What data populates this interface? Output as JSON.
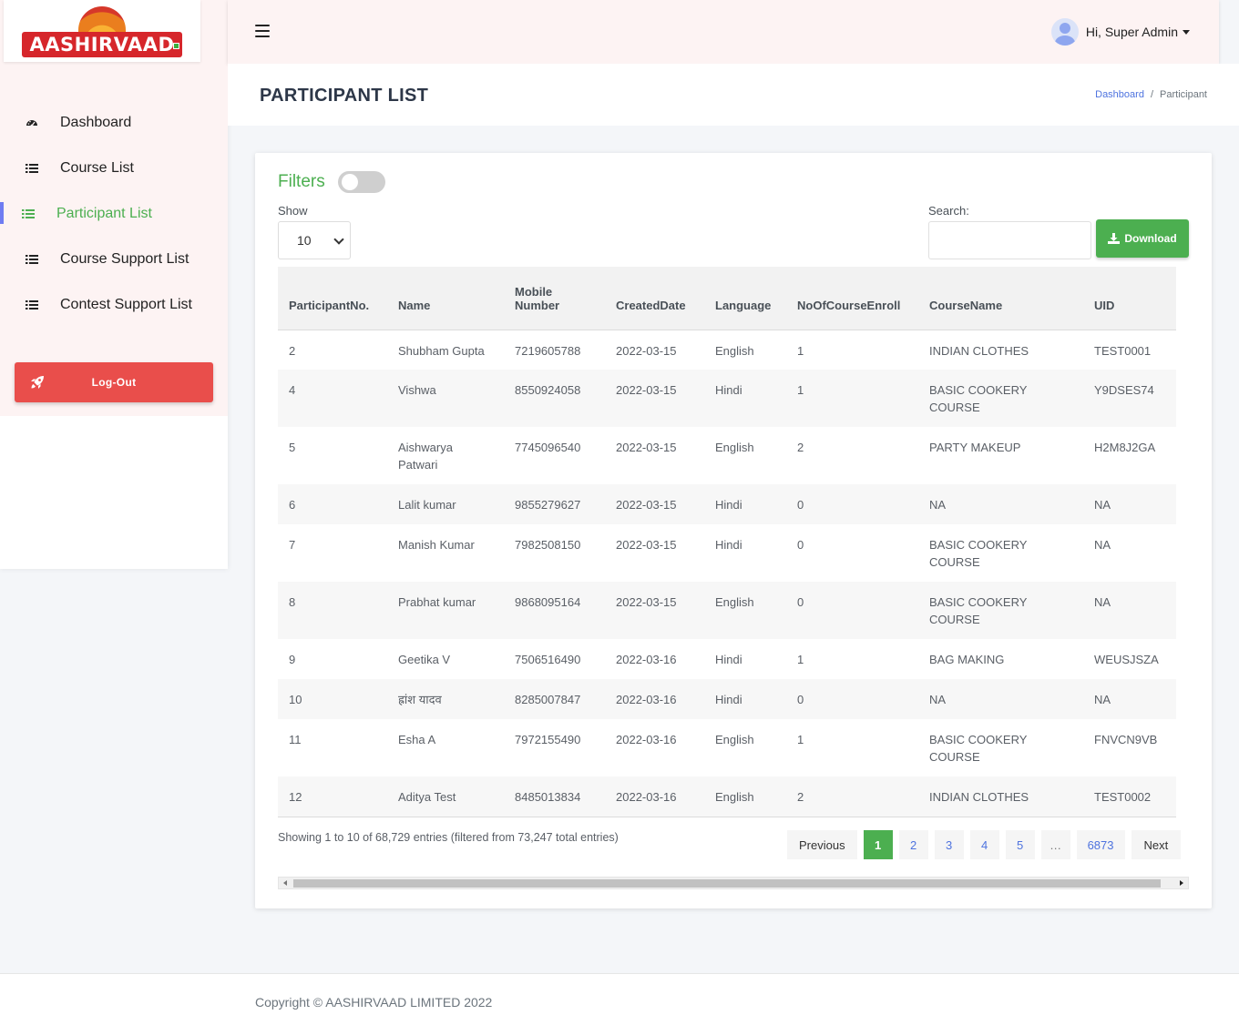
{
  "brand": {
    "logo_text": "AASHIRVAAD",
    "red": "#d6262b",
    "green": "#4caf50"
  },
  "sidebar": {
    "items": [
      {
        "label": "Dashboard",
        "icon": "dashboard-icon"
      },
      {
        "label": "Course List",
        "icon": "list-icon"
      },
      {
        "label": "Participant List",
        "icon": "list-icon",
        "active": true
      },
      {
        "label": "Course Support List",
        "icon": "list-icon"
      },
      {
        "label": "Contest Support List",
        "icon": "list-icon"
      }
    ],
    "logout_label": "Log-Out"
  },
  "topbar": {
    "user_greeting": "Hi, Super Admin"
  },
  "header": {
    "title": "PARTICIPANT LIST",
    "breadcrumb": {
      "home": "Dashboard",
      "separator": "/",
      "current": "Participant"
    }
  },
  "filters": {
    "label": "Filters",
    "show_label": "Show",
    "show_value": "10",
    "search_label": "Search:",
    "search_value": "",
    "download_label": "Download"
  },
  "table": {
    "columns": [
      "ParticipantNo.",
      "Name",
      "Mobile Number",
      "CreatedDate",
      "Language",
      "NoOfCourseEnroll",
      "CourseName",
      "UID"
    ],
    "rows": [
      [
        "2",
        "Shubham Gupta",
        "7219605788",
        "2022-03-15",
        "English",
        "1",
        "INDIAN CLOTHES",
        "TEST0001"
      ],
      [
        "4",
        "Vishwa",
        "8550924058",
        "2022-03-15",
        "Hindi",
        "1",
        "BASIC COOKERY COURSE",
        "Y9DSES74"
      ],
      [
        "5",
        "Aishwarya Patwari",
        "7745096540",
        "2022-03-15",
        "English",
        "2",
        "PARTY MAKEUP",
        "H2M8J2GA"
      ],
      [
        "6",
        "Lalit kumar",
        "9855279627",
        "2022-03-15",
        "Hindi",
        "0",
        "NA",
        "NA"
      ],
      [
        "7",
        "Manish Kumar",
        "7982508150",
        "2022-03-15",
        "Hindi",
        "0",
        "BASIC COOKERY COURSE",
        "NA"
      ],
      [
        "8",
        "Prabhat kumar",
        "9868095164",
        "2022-03-15",
        "English",
        "0",
        "BASIC COOKERY COURSE",
        "NA"
      ],
      [
        "9",
        "Geetika V",
        "7506516490",
        "2022-03-16",
        "Hindi",
        "1",
        "BAG MAKING",
        "WEUSJSZA"
      ],
      [
        "10",
        "ह्रांश यादव",
        "8285007847",
        "2022-03-16",
        "Hindi",
        "0",
        "NA",
        "NA"
      ],
      [
        "11",
        "Esha A",
        "7972155490",
        "2022-03-16",
        "English",
        "1",
        "BASIC COOKERY COURSE",
        "FNVCN9VB"
      ],
      [
        "12",
        "Aditya Test",
        "8485013834",
        "2022-03-16",
        "English",
        "2",
        "INDIAN CLOTHES",
        "TEST0002"
      ]
    ]
  },
  "pagination": {
    "info": "Showing 1 to 10 of 68,729 entries (filtered from 73,247 total entries)",
    "previous": "Previous",
    "pages": [
      "1",
      "2",
      "3",
      "4",
      "5",
      "…",
      "6873"
    ],
    "active": "1",
    "next": "Next"
  },
  "footer": {
    "copyright": "Copyright © AASHIRVAAD LIMITED 2022"
  }
}
